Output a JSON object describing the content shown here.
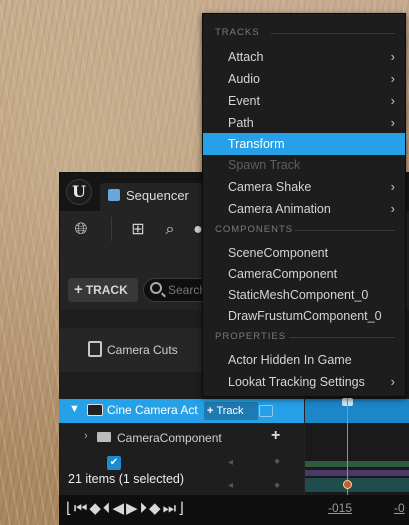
{
  "menu": {
    "sections": {
      "tracks": "TRACKS",
      "components": "COMPONENTS",
      "properties": "PROPERTIES"
    },
    "tracks_items": [
      {
        "label": "Attach",
        "submenu": true
      },
      {
        "label": "Audio",
        "submenu": true
      },
      {
        "label": "Event",
        "submenu": true
      },
      {
        "label": "Path",
        "submenu": true
      },
      {
        "label": "Transform",
        "submenu": false,
        "highlighted": true
      },
      {
        "label": "Spawn Track",
        "submenu": false,
        "disabled": true
      },
      {
        "label": "Camera Shake",
        "submenu": true
      },
      {
        "label": "Camera Animation",
        "submenu": true
      }
    ],
    "components_items": [
      {
        "label": "SceneComponent"
      },
      {
        "label": "CameraComponent"
      },
      {
        "label": "StaticMeshComponent_0"
      },
      {
        "label": "DrawFrustumComponent_0"
      }
    ],
    "properties_items": [
      {
        "label": "Actor Hidden In Game",
        "submenu": false
      },
      {
        "label": "Lookat Tracking Settings",
        "submenu": true
      }
    ]
  },
  "sequencer": {
    "tab_label": "Sequencer",
    "add_track_label": "TRACK",
    "search_placeholder": "Search",
    "camera_cuts_label": "Camera Cuts",
    "cine_row_label": "Cine Camera Act",
    "cine_track_button": "Track",
    "camera_component_label": "CameraComponent",
    "status_text": "21 items (1 selected)",
    "ruler_labels": [
      "-015",
      "-0"
    ]
  },
  "colors": {
    "accent": "#26a0e6",
    "panel": "#242424",
    "menu": "#1d1d1d"
  }
}
